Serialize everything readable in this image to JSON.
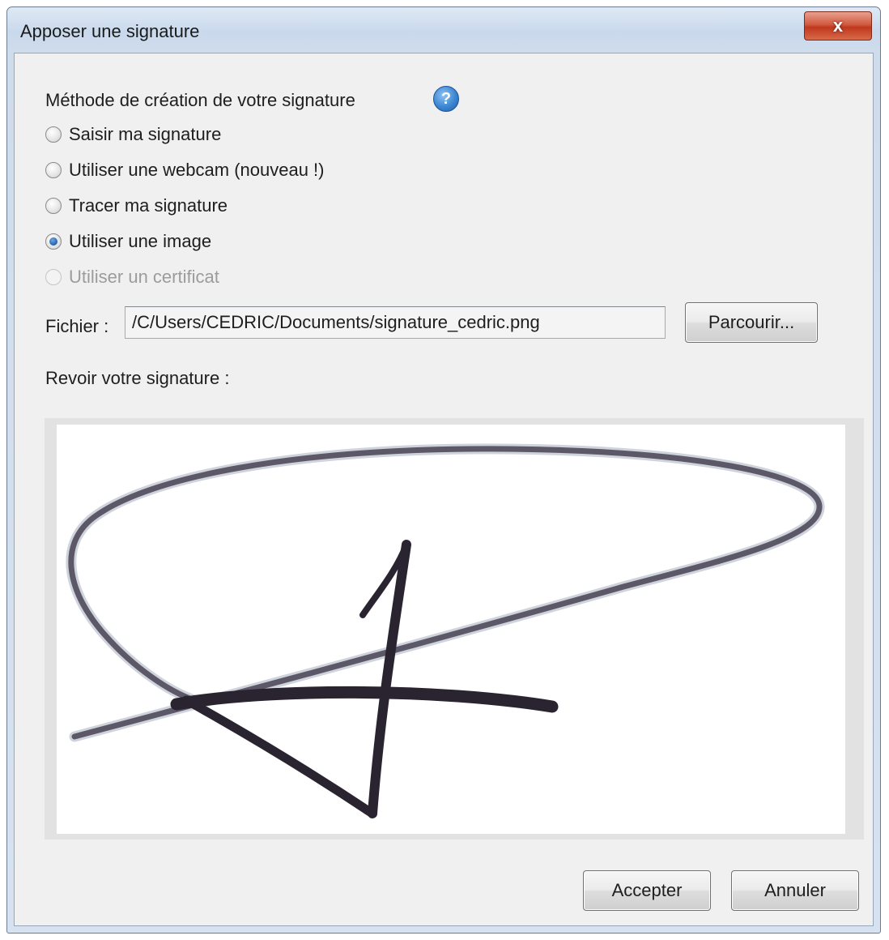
{
  "window": {
    "title": "Apposer une signature",
    "close_label": "x"
  },
  "method": {
    "title": "Méthode de création de votre signature",
    "help_symbol": "?",
    "options": [
      {
        "label": "Saisir ma signature",
        "checked": false,
        "disabled": false
      },
      {
        "label": "Utiliser une webcam (nouveau !)",
        "checked": false,
        "disabled": false
      },
      {
        "label": "Tracer ma signature",
        "checked": false,
        "disabled": false
      },
      {
        "label": "Utiliser une image",
        "checked": true,
        "disabled": false
      },
      {
        "label": "Utiliser un certificat",
        "checked": false,
        "disabled": true
      }
    ]
  },
  "file": {
    "label": "Fichier :",
    "value": "/C/Users/CEDRIC/Documents/signature_cedric.png",
    "browse_label": "Parcourir..."
  },
  "review": {
    "label": "Revoir votre signature :"
  },
  "footer": {
    "accept_label": "Accepter",
    "cancel_label": "Annuler"
  },
  "colors": {
    "accent": "#1f5fae",
    "ink": "#2a2430"
  }
}
